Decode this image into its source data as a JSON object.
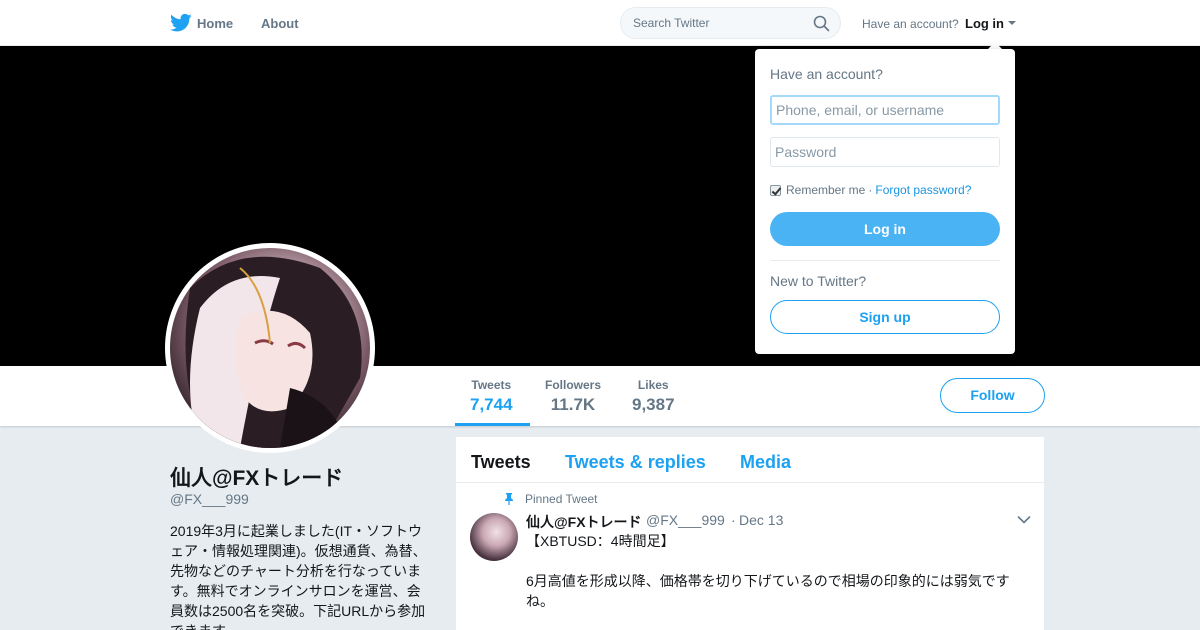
{
  "nav": {
    "home": "Home",
    "about": "About",
    "search_placeholder": "Search Twitter",
    "have_account": "Have an account?",
    "login": "Log in"
  },
  "profile": {
    "name": "仙人@FXトレード",
    "handle": "@FX___999",
    "bio": "2019年3月に起業しました(IT・ソフトウェア・情報処理関連)。仮想通貨、為替、先物などのチャート分析を行なっています。無料でオンラインサロンを運営、会員数は2500名を突破。下記URLから参加できます"
  },
  "stats": [
    {
      "label": "Tweets",
      "value": "7,744"
    },
    {
      "label": "Followers",
      "value": "11.7K"
    },
    {
      "label": "Likes",
      "value": "9,387"
    }
  ],
  "follow_label": "Follow",
  "tabs": [
    "Tweets",
    "Tweets & replies",
    "Media"
  ],
  "tweet": {
    "pinned_label": "Pinned Tweet",
    "name": "仙人@FXトレード",
    "handle": "@FX___999",
    "separator": "·",
    "date": "Dec 13",
    "text": "【XBTUSD：4時間足】\n\n6月高値を形成以降、価格帯を切り下げているので相場の印象的には弱気ですね。"
  },
  "login_dropdown": {
    "title": "Have an account?",
    "username_placeholder": "Phone, email, or username",
    "password_placeholder": "Password",
    "remember_me": "Remember me",
    "separator": "·",
    "forgot_password": "Forgot password?",
    "login_button": "Log in",
    "new_to_twitter": "New to Twitter?",
    "signup_button": "Sign up"
  },
  "colors": {
    "brand": "#1da1f2",
    "banner": "#000000"
  }
}
